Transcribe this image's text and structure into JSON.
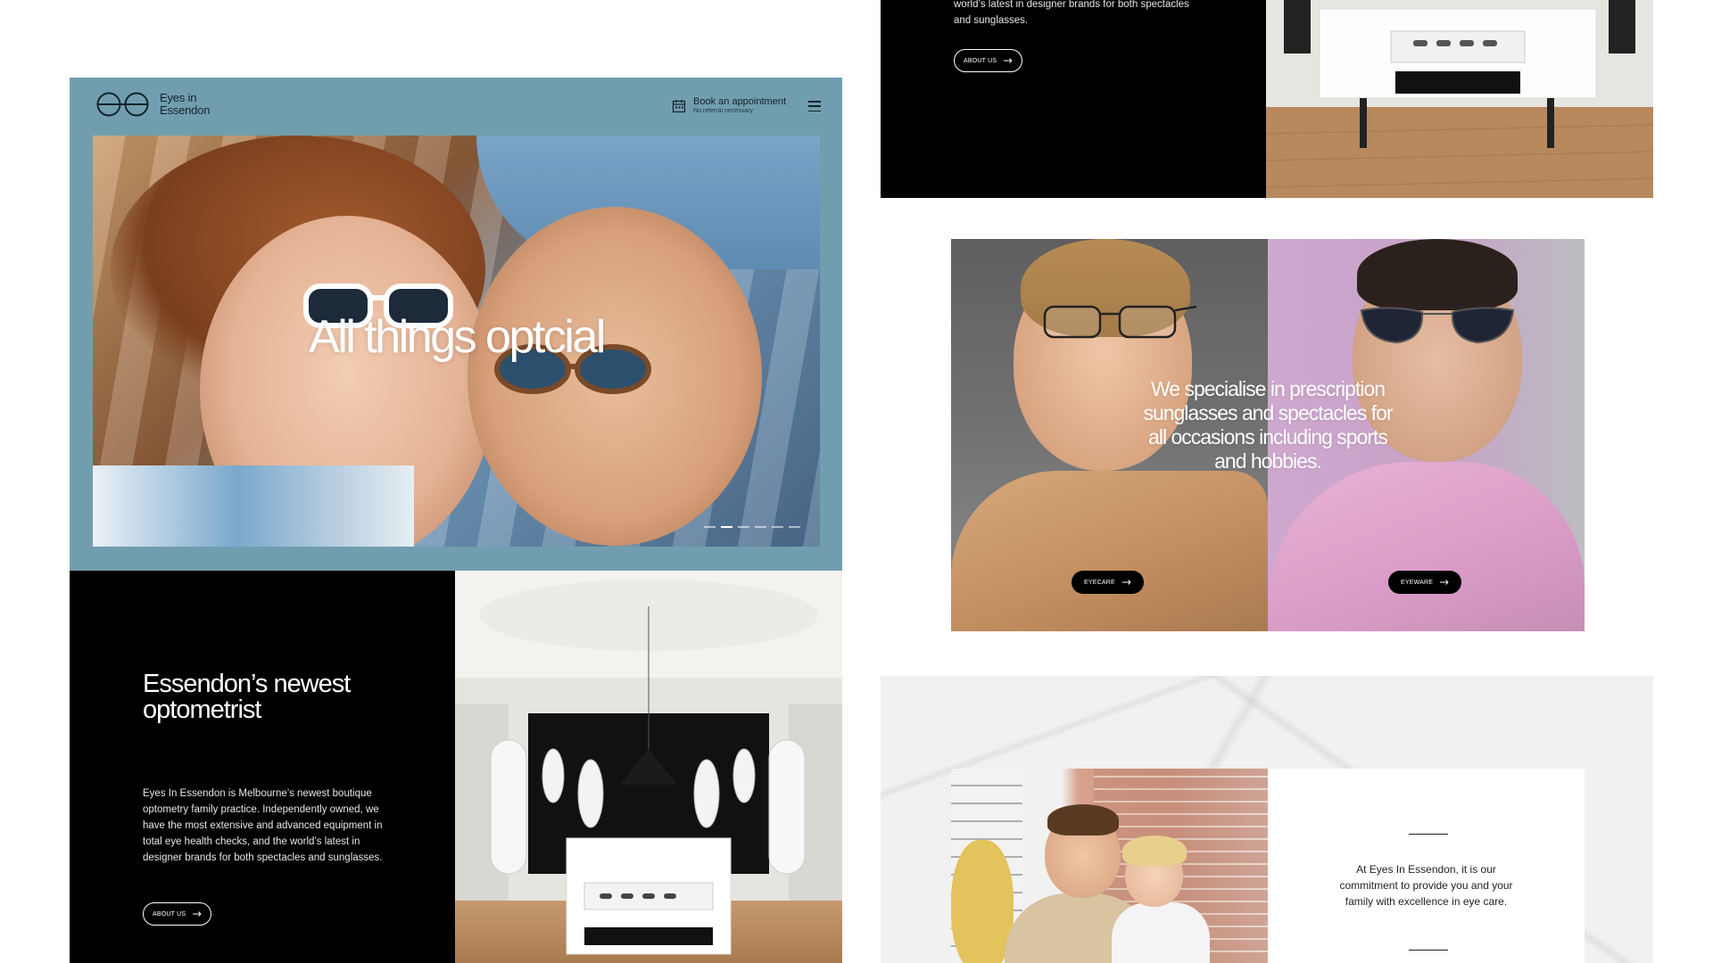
{
  "brand": {
    "name": "Eyes in Essendon"
  },
  "header": {
    "book_label": "Book an appointment",
    "book_sub": "No referral necessary"
  },
  "hero": {
    "title": "All things optcial",
    "slide_count": 6,
    "active_slide": 2
  },
  "about": {
    "heading": "Essendon’s newest optometrist",
    "body": "Eyes In Essendon is Melbourne’s newest boutique optometry family practice. Independently owned, we have the most extensive and advanced equipment in total eye health checks, and the world’s latest in designer brands for both spectacles and sunglasses.",
    "button_label": "ABOUT US"
  },
  "scrolled": {
    "body_fragment": "world’s latest in designer brands for both spectacles and sunglasses.",
    "button_label": "ABOUT US"
  },
  "specialise": {
    "text": "We specialise in prescription sunglasses and spectacles for all occasions including sports and hobbies.",
    "eyecare_label": "EYECARE",
    "eyeware_label": "EYEWARE"
  },
  "commitment": {
    "text": "At Eyes In Essendon, it is our commitment to provide you and your family with excellence in eye care."
  },
  "colors": {
    "header_band": "#719eaf",
    "dark": "#000000",
    "text_light": "#ffffff"
  },
  "icons": {
    "logo": "glasses-logo-icon",
    "calendar": "calendar-icon",
    "menu": "hamburger-menu-icon",
    "arrow": "arrow-right-icon"
  }
}
